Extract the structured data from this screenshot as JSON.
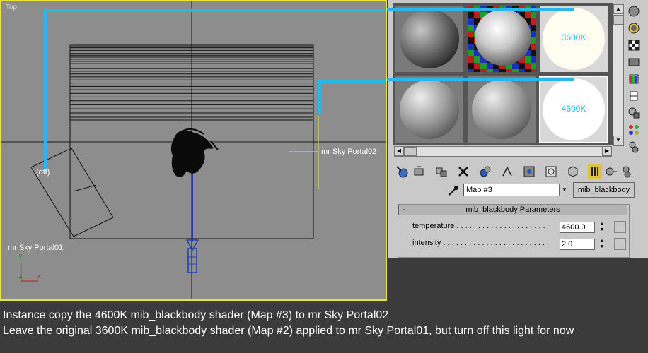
{
  "viewport": {
    "label": "Top",
    "objects": {
      "off_label": "(off)",
      "portal01_label": "mr Sky Portal01",
      "portal02_label": "mr Sky Portal02"
    },
    "axes": {
      "y": "y",
      "x": "x",
      "z": "z"
    }
  },
  "material_editor": {
    "slots": [
      {
        "text": ""
      },
      {
        "text": ""
      },
      {
        "text": "3600K"
      },
      {
        "text": ""
      },
      {
        "text": ""
      },
      {
        "text": "4600K"
      }
    ],
    "map_name": "Map #3",
    "type_button": "mib_blackbody",
    "rollout": {
      "title": "mib_blackbody Parameters",
      "collapse": "-",
      "params": [
        {
          "label": "temperature",
          "value": "4600.0"
        },
        {
          "label": "intensity",
          "value": "2.0"
        }
      ]
    }
  },
  "captions": [
    "Instance copy the 4600K mib_blackbody shader (Map #3) to mr Sky Portal02",
    "Leave the original 3600K mib_blackbody shader (Map #2) applied to mr Sky Portal01, but turn off this light for now"
  ],
  "colors": {
    "annotation": "#29b6e8",
    "viewport_border": "#e8e337",
    "viewport_bg": "#8d8d8d"
  },
  "icons": [
    "pick-material-icon",
    "put-to-scene-icon",
    "assign-material-icon",
    "reset-icon",
    "make-unique-icon",
    "put-to-library-icon",
    "material-id-icon",
    "show-map-icon",
    "show-end-result-icon",
    "go-to-parent-icon",
    "go-forward-icon",
    "sample-type-icon",
    "backlight-icon",
    "background-icon",
    "sample-uv-icon",
    "video-check-icon",
    "make-preview-icon",
    "options-icon",
    "select-by-material-icon",
    "material-navigator-icon",
    "eyedropper-icon"
  ]
}
